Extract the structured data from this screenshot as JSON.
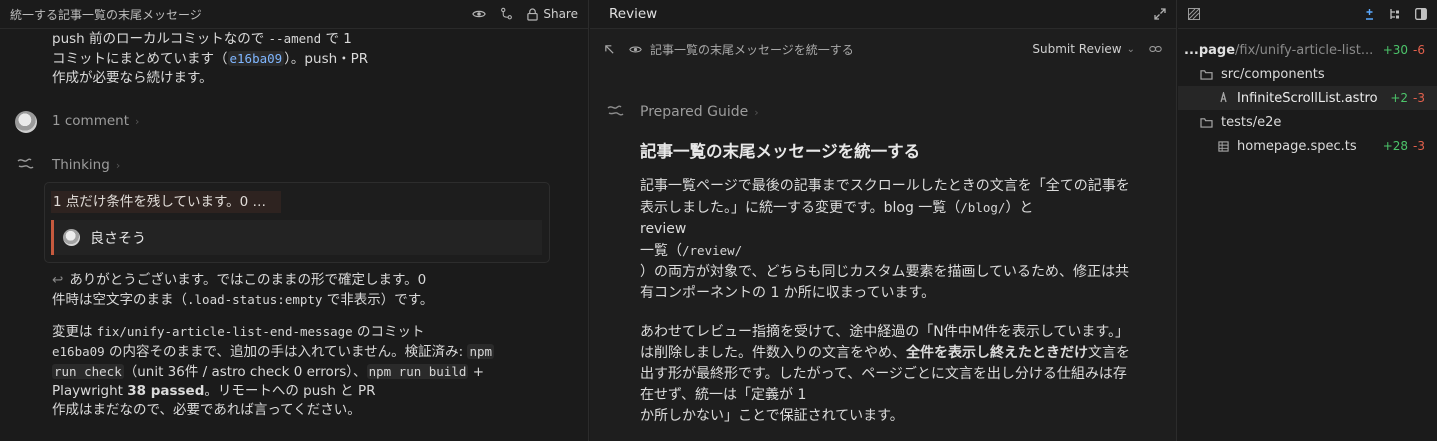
{
  "left": {
    "title": "統一する記事一覧の末尾メッセージ",
    "share_label": "Share",
    "msg_top": {
      "line1_a": "push 前のローカルコミットなので ",
      "line1_code": "--amend",
      "line1_b": " で 1",
      "line2_a": "コミットにまとめています（",
      "line2_hash": "e16ba09",
      "line2_b": "）。push・PR",
      "line3": "作成が必要なら続けます。"
    },
    "comment_count": "1 comment",
    "thinking_label": "Thinking",
    "card": {
      "highlight": "1 点だけ条件を残しています。0 …",
      "quote": "良さそう"
    },
    "reply": {
      "line1": "ありがとうございます。ではこのままの形で確定します。0",
      "line2_a": "件時は空文字のまま（",
      "line2_code": ".load-status:empty",
      "line2_b": " で非表示）です。",
      "line3_a": "変更は ",
      "line3_code": "fix/unify-article-list-end-message",
      "line3_b": " のコミット",
      "line4_code": "e16ba09",
      "line4_b": " の内容そのままで、追加の手は入れていません。検証済み: ",
      "line4_code2": "npm",
      "line5_code": "run check",
      "line5_b": "（unit 36件 / astro check 0 errors）、",
      "line5_code2": "npm run build",
      "line5_c": " +",
      "line6_a": "Playwright ",
      "line6_bold": "38 passed",
      "line6_b": "。リモートへの push と PR",
      "line7": "作成はまだなので、必要であれば言ってください。"
    }
  },
  "mid": {
    "tab_label": "Review",
    "breadcrumb": "記事一覧の末尾メッセージを統一する",
    "submit_label": "Submit Review",
    "guide_label": "Prepared Guide",
    "heading": "記事一覧の末尾メッセージを統一する",
    "p1_a": "記事一覧ページで最後の記事までスクロールしたときの文言を「全ての記事を表示しました。」に統一する変更です。blog 一覧（",
    "p1_code1": "/blog/",
    "p1_b": "）と",
    "p1_line_review": "review",
    "p1_line_review2_a": "一覧（",
    "p1_line_review2_code": "/review/",
    "p1_c": "）の両方が対象で、どちらも同じカスタム要素を描画しているため、修正は共有コンポーネントの 1 か所に収まっています。",
    "p2_a": "あわせてレビュー指摘を受けて、途中経過の「N件中M件を表示しています。」は削除しました。件数入りの文言をやめ、",
    "p2_bold": "全件を表示し終えたときだけ",
    "p2_b": "文言を出す形が最終形です。したがって、ページごとに文言を出し分ける仕組みは存在せず、統一は「定義が 1",
    "p2_c": "か所しかない」ことで保証されています。"
  },
  "right": {
    "path_prefix": "...page",
    "path_rest": "/fix/unify-article-list...",
    "path_add": "+30",
    "path_del": "-6",
    "items": [
      {
        "label": "src/components",
        "type": "folder"
      },
      {
        "label": "InfiniteScrollList.astro",
        "type": "file",
        "add": "+2",
        "del": "-3"
      },
      {
        "label": "tests/e2e",
        "type": "folder"
      },
      {
        "label": "homepage.spec.ts",
        "type": "file",
        "add": "+28",
        "del": "-3"
      }
    ]
  }
}
